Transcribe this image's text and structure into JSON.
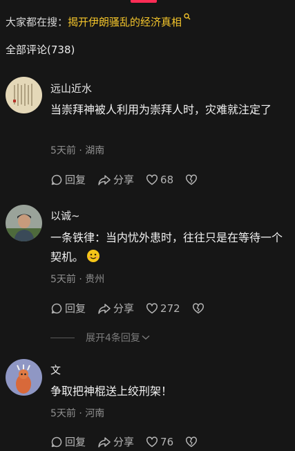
{
  "search": {
    "prefix": "大家都在搜：",
    "term": "揭开伊朗骚乱的经济真相"
  },
  "comments_header": {
    "label": "全部评论(738)"
  },
  "comments": [
    {
      "username": "远山近水",
      "text": "当崇拜神被人利用为崇拜人时，灾难就注定了",
      "meta": "5天前 · 湖南",
      "reply_label": "回复",
      "share_label": "分享",
      "likes": "68"
    },
    {
      "username": "以诚~",
      "text": "一条铁律：当内忧外患时，往往只是在等待一个契机。",
      "meta": "5天前 · 贵州",
      "reply_label": "回复",
      "share_label": "分享",
      "likes": "272"
    },
    {
      "username": "文",
      "text": "争取把神棍送上绞刑架！",
      "meta": "5天前 · 河南",
      "reply_label": "回复",
      "share_label": "分享",
      "likes": "76"
    }
  ],
  "expand_replies": {
    "label": "展开4条回复"
  },
  "colors": {
    "background": "#161616",
    "accent": "#fe2c55",
    "search_term": "#f4c52b",
    "meta": "#8f8f8f"
  },
  "icons": [
    "search-icon",
    "reply-icon",
    "share-icon",
    "like-heart-icon",
    "dislike-broken-heart-icon",
    "chevron-down-icon",
    "smile-emoji"
  ]
}
